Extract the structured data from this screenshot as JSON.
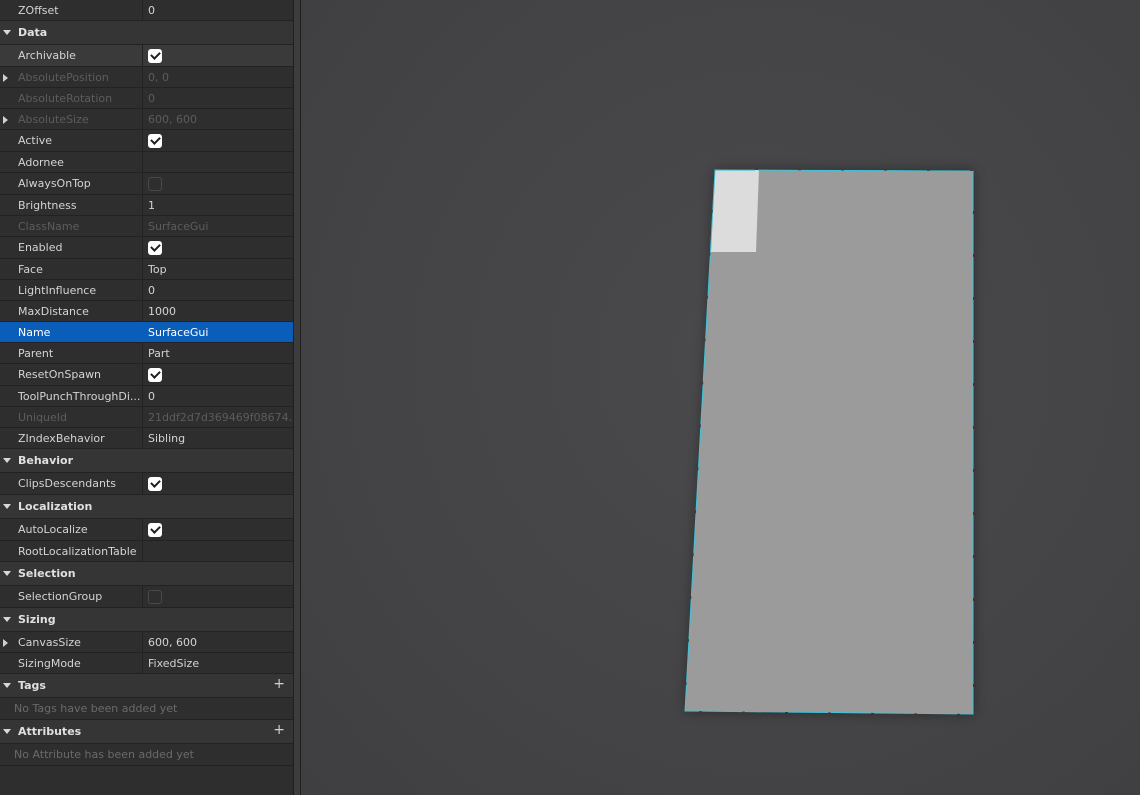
{
  "properties_panel": {
    "rows": [
      {
        "kind": "prop",
        "name": "ZOffset",
        "value": "0",
        "type": "text"
      },
      {
        "kind": "section",
        "label": "Data"
      },
      {
        "kind": "prop",
        "name": "Archivable",
        "type": "check",
        "checked": true,
        "hover": true
      },
      {
        "kind": "prop",
        "name": "AbsolutePosition",
        "value": "0, 0",
        "type": "text",
        "disabled": true,
        "expandable": true
      },
      {
        "kind": "prop",
        "name": "AbsoluteRotation",
        "value": "0",
        "type": "text",
        "disabled": true
      },
      {
        "kind": "prop",
        "name": "AbsoluteSize",
        "value": "600, 600",
        "type": "text",
        "disabled": true,
        "expandable": true
      },
      {
        "kind": "prop",
        "name": "Active",
        "type": "check",
        "checked": true
      },
      {
        "kind": "prop",
        "name": "Adornee",
        "value": "",
        "type": "text"
      },
      {
        "kind": "prop",
        "name": "AlwaysOnTop",
        "type": "check",
        "checked": false
      },
      {
        "kind": "prop",
        "name": "Brightness",
        "value": "1",
        "type": "text"
      },
      {
        "kind": "prop",
        "name": "ClassName",
        "value": "SurfaceGui",
        "type": "text",
        "disabled": true
      },
      {
        "kind": "prop",
        "name": "Enabled",
        "type": "check",
        "checked": true
      },
      {
        "kind": "prop",
        "name": "Face",
        "value": "Top",
        "type": "text"
      },
      {
        "kind": "prop",
        "name": "LightInfluence",
        "value": "0",
        "type": "text"
      },
      {
        "kind": "prop",
        "name": "MaxDistance",
        "value": "1000",
        "type": "text"
      },
      {
        "kind": "prop",
        "name": "Name",
        "value": "SurfaceGui",
        "type": "text",
        "selected": true
      },
      {
        "kind": "prop",
        "name": "Parent",
        "value": "Part",
        "type": "text"
      },
      {
        "kind": "prop",
        "name": "ResetOnSpawn",
        "type": "check",
        "checked": true
      },
      {
        "kind": "prop",
        "name": "ToolPunchThroughDi...",
        "value": "0",
        "type": "text"
      },
      {
        "kind": "prop",
        "name": "UniqueId",
        "value": "21ddf2d7d369469f08674...",
        "type": "text",
        "disabled": true
      },
      {
        "kind": "prop",
        "name": "ZIndexBehavior",
        "value": "Sibling",
        "type": "text"
      },
      {
        "kind": "section",
        "label": "Behavior"
      },
      {
        "kind": "prop",
        "name": "ClipsDescendants",
        "type": "check",
        "checked": true
      },
      {
        "kind": "section",
        "label": "Localization"
      },
      {
        "kind": "prop",
        "name": "AutoLocalize",
        "type": "check",
        "checked": true
      },
      {
        "kind": "prop",
        "name": "RootLocalizationTable",
        "value": "",
        "type": "text"
      },
      {
        "kind": "section",
        "label": "Selection"
      },
      {
        "kind": "prop",
        "name": "SelectionGroup",
        "type": "check",
        "checked": false
      },
      {
        "kind": "section",
        "label": "Sizing"
      },
      {
        "kind": "prop",
        "name": "CanvasSize",
        "value": "600, 600",
        "type": "text",
        "expandable": true
      },
      {
        "kind": "prop",
        "name": "SizingMode",
        "value": "FixedSize",
        "type": "text"
      },
      {
        "kind": "section",
        "label": "Tags",
        "plus": true
      },
      {
        "kind": "empty",
        "text": "No Tags have been added yet"
      },
      {
        "kind": "section",
        "label": "Attributes",
        "plus": true
      },
      {
        "kind": "empty",
        "text": "No Attribute has been added yet"
      }
    ],
    "plus_glyph": "+"
  },
  "viewport": {
    "part_color": "#9b9b9b",
    "highlight_color": "#dcdcdc",
    "outline_color": "#3fc3d8"
  }
}
